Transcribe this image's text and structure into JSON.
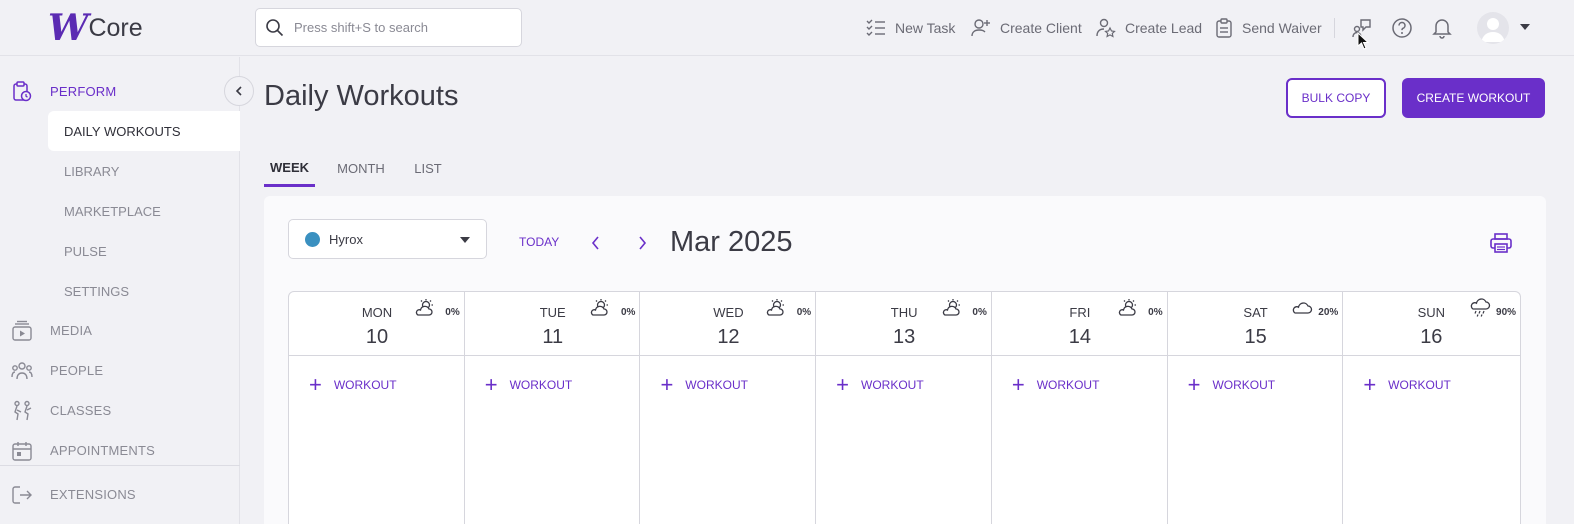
{
  "brand": {
    "mark": "W",
    "name": "Core"
  },
  "search": {
    "placeholder": "Press shift+S to search"
  },
  "top_actions": [
    {
      "label": "New Task",
      "icon": "task-list-icon"
    },
    {
      "label": "Create Client",
      "icon": "add-user-icon"
    },
    {
      "label": "Create Lead",
      "icon": "lead-star-icon"
    },
    {
      "label": "Send Waiver",
      "icon": "clipboard-icon"
    }
  ],
  "sidebar": {
    "sections": [
      {
        "label": "PERFORM",
        "icon": "clipboard-icon",
        "active": true
      },
      {
        "label": "MEDIA",
        "icon": "media-icon"
      },
      {
        "label": "PEOPLE",
        "icon": "people-icon"
      },
      {
        "label": "CLASSES",
        "icon": "classes-icon"
      },
      {
        "label": "APPOINTMENTS",
        "icon": "calendar-icon"
      },
      {
        "label": "EXTENSIONS",
        "icon": "extensions-icon"
      }
    ],
    "perform_items": [
      {
        "label": "DAILY WORKOUTS",
        "active": true
      },
      {
        "label": "LIBRARY"
      },
      {
        "label": "MARKETPLACE"
      },
      {
        "label": "PULSE"
      },
      {
        "label": "SETTINGS"
      }
    ]
  },
  "page": {
    "title": "Daily Workouts",
    "bulk_copy": "BULK COPY",
    "create_workout": "CREATE WORKOUT",
    "tabs": [
      "WEEK",
      "MONTH",
      "LIST"
    ],
    "active_tab": "WEEK"
  },
  "calendar": {
    "program": {
      "name": "Hyrox",
      "color": "#3a90c0"
    },
    "today_label": "TODAY",
    "month": "Mar 2025",
    "days": [
      {
        "name": "MON",
        "num": "10",
        "precip": "0%",
        "weather": "partly-cloudy-icon"
      },
      {
        "name": "TUE",
        "num": "11",
        "precip": "0%",
        "weather": "partly-cloudy-icon"
      },
      {
        "name": "WED",
        "num": "12",
        "precip": "0%",
        "weather": "partly-cloudy-icon"
      },
      {
        "name": "THU",
        "num": "13",
        "precip": "0%",
        "weather": "partly-cloudy-icon"
      },
      {
        "name": "FRI",
        "num": "14",
        "precip": "0%",
        "weather": "partly-cloudy-icon"
      },
      {
        "name": "SAT",
        "num": "15",
        "precip": "20%",
        "weather": "cloud-icon"
      },
      {
        "name": "SUN",
        "num": "16",
        "precip": "90%",
        "weather": "rain-icon"
      }
    ],
    "add_label": "WORKOUT"
  },
  "colors": {
    "accent": "#6a2fc9",
    "background": "#f1f1f5"
  }
}
